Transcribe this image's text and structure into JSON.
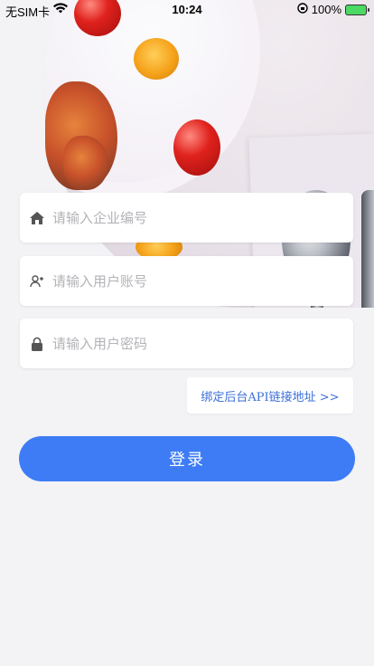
{
  "status_bar": {
    "carrier": "无SIM卡",
    "time": "10:24",
    "battery": "100%"
  },
  "form": {
    "company_placeholder": "请输入企业编号",
    "username_placeholder": "请输入用户账号",
    "password_placeholder": "请输入用户密码"
  },
  "api_link_label": "绑定后台API链接地址 >>",
  "login_label": "登录",
  "icons": {
    "company": "home-icon",
    "username": "user-plus-icon",
    "password": "lock-icon"
  },
  "colors": {
    "primary": "#3d7cf5",
    "link": "#3a6fd8",
    "background": "#f3f3f6"
  }
}
